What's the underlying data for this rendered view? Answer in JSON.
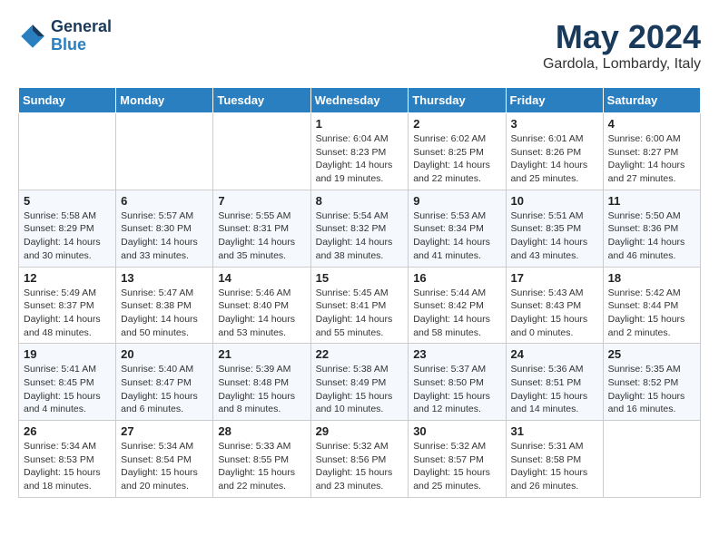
{
  "header": {
    "logo_line1": "General",
    "logo_line2": "Blue",
    "month_title": "May 2024",
    "location": "Gardola, Lombardy, Italy"
  },
  "weekdays": [
    "Sunday",
    "Monday",
    "Tuesday",
    "Wednesday",
    "Thursday",
    "Friday",
    "Saturday"
  ],
  "weeks": [
    [
      {
        "day": "",
        "info": ""
      },
      {
        "day": "",
        "info": ""
      },
      {
        "day": "",
        "info": ""
      },
      {
        "day": "1",
        "info": "Sunrise: 6:04 AM\nSunset: 8:23 PM\nDaylight: 14 hours\nand 19 minutes."
      },
      {
        "day": "2",
        "info": "Sunrise: 6:02 AM\nSunset: 8:25 PM\nDaylight: 14 hours\nand 22 minutes."
      },
      {
        "day": "3",
        "info": "Sunrise: 6:01 AM\nSunset: 8:26 PM\nDaylight: 14 hours\nand 25 minutes."
      },
      {
        "day": "4",
        "info": "Sunrise: 6:00 AM\nSunset: 8:27 PM\nDaylight: 14 hours\nand 27 minutes."
      }
    ],
    [
      {
        "day": "5",
        "info": "Sunrise: 5:58 AM\nSunset: 8:29 PM\nDaylight: 14 hours\nand 30 minutes."
      },
      {
        "day": "6",
        "info": "Sunrise: 5:57 AM\nSunset: 8:30 PM\nDaylight: 14 hours\nand 33 minutes."
      },
      {
        "day": "7",
        "info": "Sunrise: 5:55 AM\nSunset: 8:31 PM\nDaylight: 14 hours\nand 35 minutes."
      },
      {
        "day": "8",
        "info": "Sunrise: 5:54 AM\nSunset: 8:32 PM\nDaylight: 14 hours\nand 38 minutes."
      },
      {
        "day": "9",
        "info": "Sunrise: 5:53 AM\nSunset: 8:34 PM\nDaylight: 14 hours\nand 41 minutes."
      },
      {
        "day": "10",
        "info": "Sunrise: 5:51 AM\nSunset: 8:35 PM\nDaylight: 14 hours\nand 43 minutes."
      },
      {
        "day": "11",
        "info": "Sunrise: 5:50 AM\nSunset: 8:36 PM\nDaylight: 14 hours\nand 46 minutes."
      }
    ],
    [
      {
        "day": "12",
        "info": "Sunrise: 5:49 AM\nSunset: 8:37 PM\nDaylight: 14 hours\nand 48 minutes."
      },
      {
        "day": "13",
        "info": "Sunrise: 5:47 AM\nSunset: 8:38 PM\nDaylight: 14 hours\nand 50 minutes."
      },
      {
        "day": "14",
        "info": "Sunrise: 5:46 AM\nSunset: 8:40 PM\nDaylight: 14 hours\nand 53 minutes."
      },
      {
        "day": "15",
        "info": "Sunrise: 5:45 AM\nSunset: 8:41 PM\nDaylight: 14 hours\nand 55 minutes."
      },
      {
        "day": "16",
        "info": "Sunrise: 5:44 AM\nSunset: 8:42 PM\nDaylight: 14 hours\nand 58 minutes."
      },
      {
        "day": "17",
        "info": "Sunrise: 5:43 AM\nSunset: 8:43 PM\nDaylight: 15 hours\nand 0 minutes."
      },
      {
        "day": "18",
        "info": "Sunrise: 5:42 AM\nSunset: 8:44 PM\nDaylight: 15 hours\nand 2 minutes."
      }
    ],
    [
      {
        "day": "19",
        "info": "Sunrise: 5:41 AM\nSunset: 8:45 PM\nDaylight: 15 hours\nand 4 minutes."
      },
      {
        "day": "20",
        "info": "Sunrise: 5:40 AM\nSunset: 8:47 PM\nDaylight: 15 hours\nand 6 minutes."
      },
      {
        "day": "21",
        "info": "Sunrise: 5:39 AM\nSunset: 8:48 PM\nDaylight: 15 hours\nand 8 minutes."
      },
      {
        "day": "22",
        "info": "Sunrise: 5:38 AM\nSunset: 8:49 PM\nDaylight: 15 hours\nand 10 minutes."
      },
      {
        "day": "23",
        "info": "Sunrise: 5:37 AM\nSunset: 8:50 PM\nDaylight: 15 hours\nand 12 minutes."
      },
      {
        "day": "24",
        "info": "Sunrise: 5:36 AM\nSunset: 8:51 PM\nDaylight: 15 hours\nand 14 minutes."
      },
      {
        "day": "25",
        "info": "Sunrise: 5:35 AM\nSunset: 8:52 PM\nDaylight: 15 hours\nand 16 minutes."
      }
    ],
    [
      {
        "day": "26",
        "info": "Sunrise: 5:34 AM\nSunset: 8:53 PM\nDaylight: 15 hours\nand 18 minutes."
      },
      {
        "day": "27",
        "info": "Sunrise: 5:34 AM\nSunset: 8:54 PM\nDaylight: 15 hours\nand 20 minutes."
      },
      {
        "day": "28",
        "info": "Sunrise: 5:33 AM\nSunset: 8:55 PM\nDaylight: 15 hours\nand 22 minutes."
      },
      {
        "day": "29",
        "info": "Sunrise: 5:32 AM\nSunset: 8:56 PM\nDaylight: 15 hours\nand 23 minutes."
      },
      {
        "day": "30",
        "info": "Sunrise: 5:32 AM\nSunset: 8:57 PM\nDaylight: 15 hours\nand 25 minutes."
      },
      {
        "day": "31",
        "info": "Sunrise: 5:31 AM\nSunset: 8:58 PM\nDaylight: 15 hours\nand 26 minutes."
      },
      {
        "day": "",
        "info": ""
      }
    ]
  ]
}
